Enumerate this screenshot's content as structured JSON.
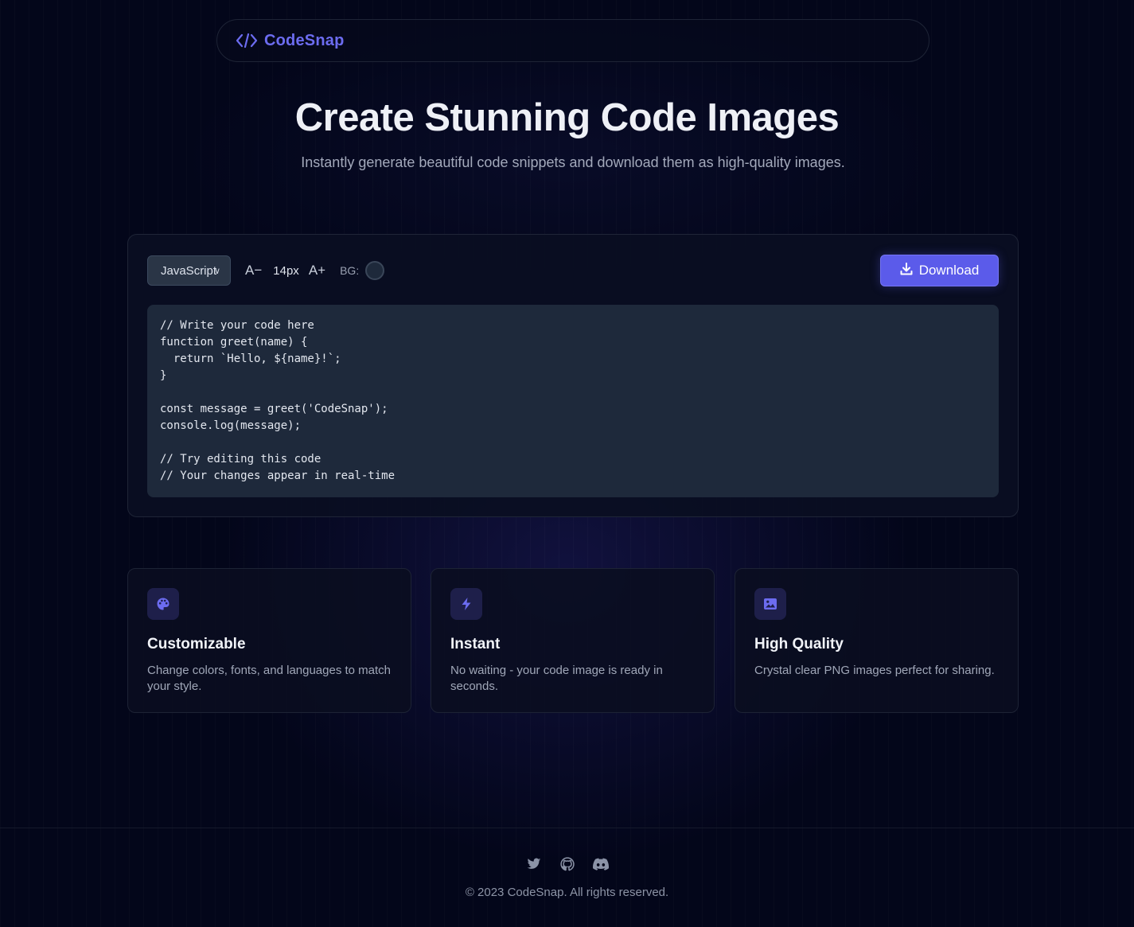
{
  "brand": {
    "name": "CodeSnap",
    "accent": "#6c6cf0"
  },
  "hero": {
    "title": "Create Stunning Code Images",
    "subtitle": "Instantly generate beautiful code snippets and download them as high-quality images."
  },
  "toolbar": {
    "language": "JavaScript",
    "font_decrease_label": "A−",
    "font_size": "14px",
    "font_increase_label": "A+",
    "bg_label": "BG:",
    "bg_color": "#1e293b",
    "download_label": "Download",
    "download_color": "#5b5bea"
  },
  "editor": {
    "code": "// Write your code here\nfunction greet(name) {\n  return `Hello, ${name}!`;\n}\n\nconst message = greet('CodeSnap');\nconsole.log(message);\n\n// Try editing this code\n// Your changes appear in real-time"
  },
  "features": [
    {
      "icon": "palette-icon",
      "title": "Customizable",
      "description": "Change colors, fonts, and languages to match your style."
    },
    {
      "icon": "lightning-icon",
      "title": "Instant",
      "description": "No waiting - your code image is ready in seconds."
    },
    {
      "icon": "image-icon",
      "title": "High Quality",
      "description": "Crystal clear PNG images perfect for sharing."
    }
  ],
  "footer": {
    "social_icons": [
      "twitter-icon",
      "github-icon",
      "discord-icon"
    ],
    "copyright": "© 2023 CodeSnap. All rights reserved."
  }
}
